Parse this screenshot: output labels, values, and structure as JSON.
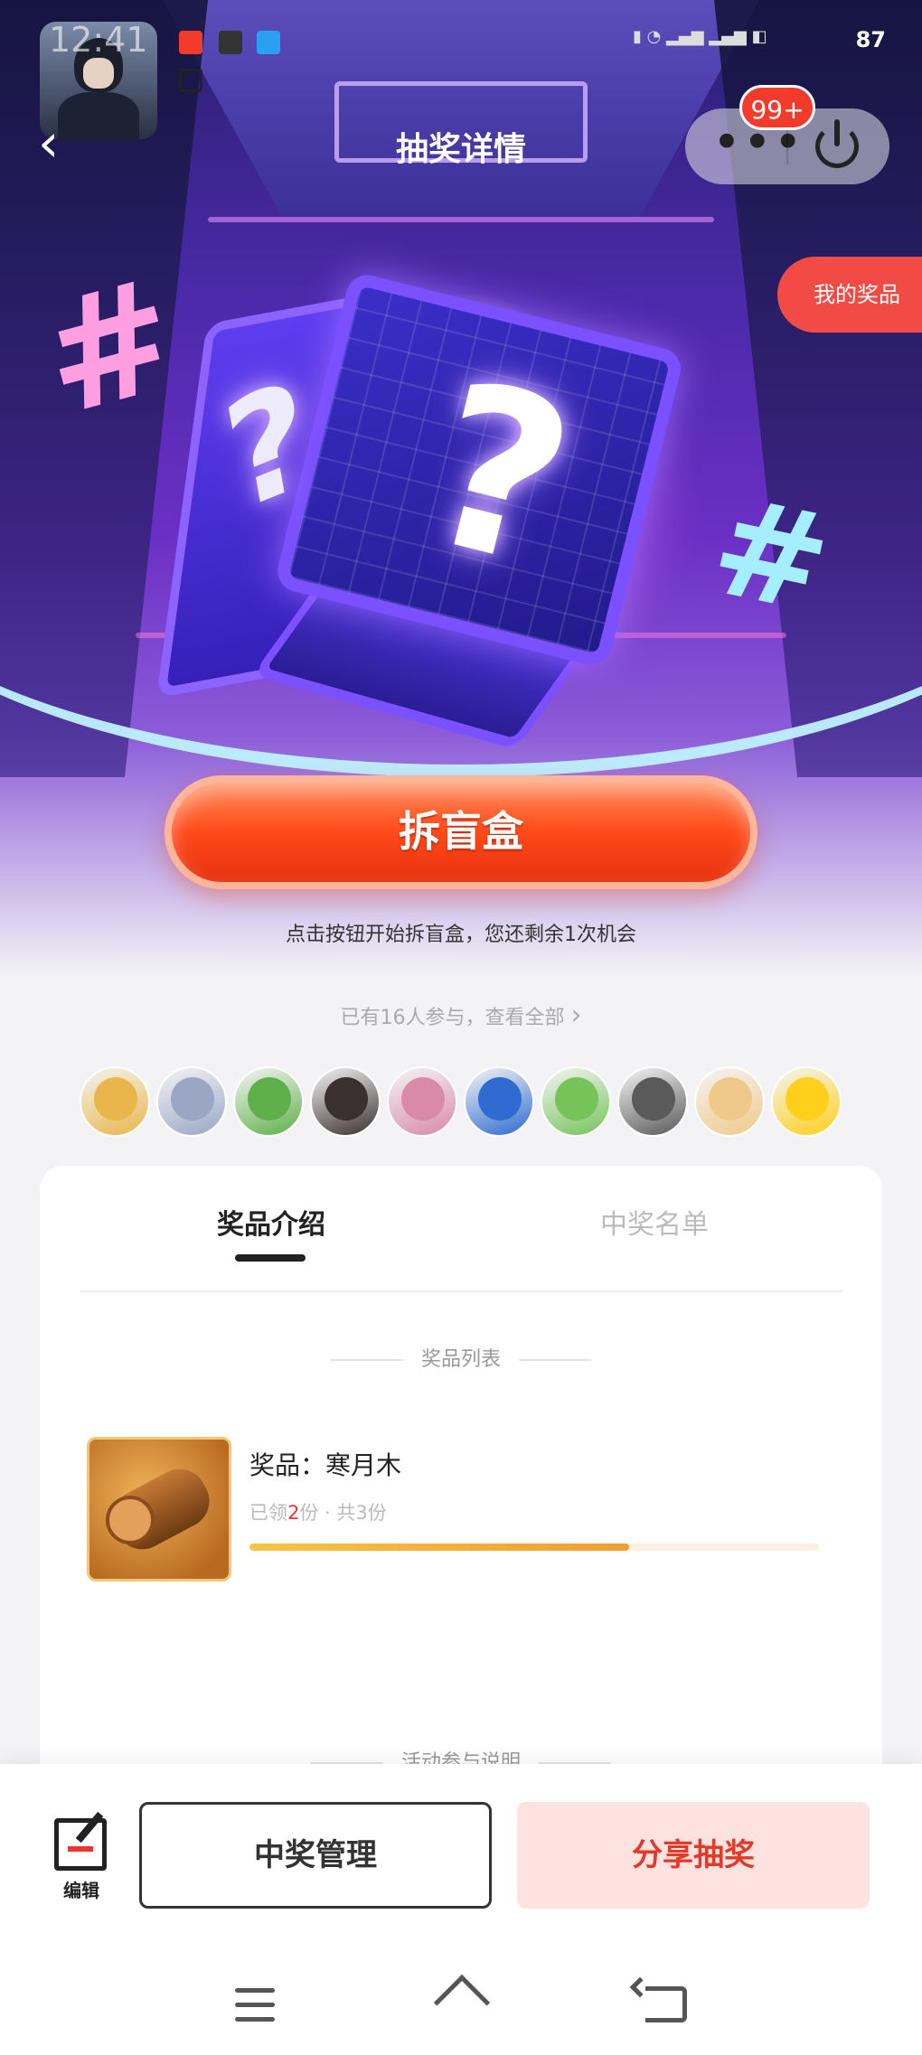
{
  "status_bar": {
    "time": "12:41",
    "battery": "87"
  },
  "header": {
    "title": "抽奖详情",
    "badge": "99+",
    "my_prize": "我的奖品"
  },
  "hero": {
    "open_button": "拆盲盒",
    "hint": "点击按钮开始拆盲盒，您还剩余1次机会"
  },
  "participants": {
    "link_text": "已有16人参与，查看全部",
    "avatar_colors": [
      "#e8b64a",
      "#9aa6c4",
      "#5fb04a",
      "#3a3030",
      "#d88aa8",
      "#2f6bd0",
      "#76c35a",
      "#5a5a5a",
      "#f0c98a",
      "#ffcf1a"
    ]
  },
  "tabs": [
    {
      "label": "奖品介绍",
      "active": true
    },
    {
      "label": "中奖名单",
      "active": false
    }
  ],
  "prizes": {
    "section_title": "奖品列表",
    "items": [
      {
        "name": "奖品：寒月木",
        "claimed_prefix": "已领",
        "claimed": "2",
        "total_text": "份 · 共3份",
        "claimed_fraction": 0.667
      }
    ]
  },
  "rules": {
    "section_title": "活动参与说明"
  },
  "bottom_bar": {
    "edit_label": "编辑",
    "manage_label": "中奖管理",
    "share_label": "分享抽奖"
  },
  "colors": {
    "accent": "#f24a45",
    "share_text": "#e23a2a",
    "share_bg": "#fde3e0",
    "progress": "#f29d30"
  }
}
